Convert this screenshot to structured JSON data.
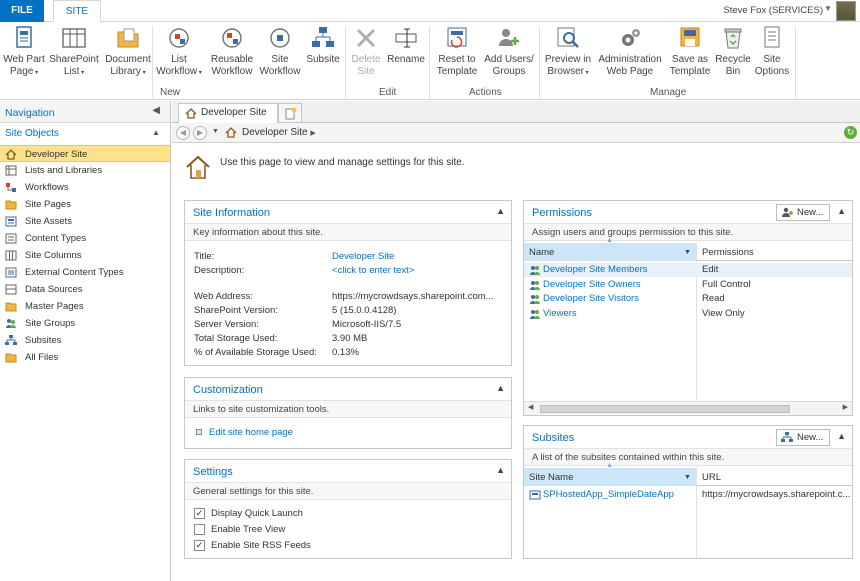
{
  "topbar": {
    "tabs": [
      {
        "label": "FILE"
      },
      {
        "label": "SITE"
      }
    ],
    "user": "Steve Fox (SERVICES)"
  },
  "ribbon": {
    "buttons": [
      {
        "label": "Web Part\nPage",
        "icon": "web-part-page-icon"
      },
      {
        "label": "SharePoint\nList",
        "icon": "sharepoint-list-icon"
      },
      {
        "label": "Document\nLibrary",
        "icon": "document-library-icon"
      },
      {
        "label": "List\nWorkflow",
        "icon": "list-workflow-icon"
      },
      {
        "label": "Reusable\nWorkflow",
        "icon": "reusable-workflow-icon"
      },
      {
        "label": "Site\nWorkflow",
        "icon": "site-workflow-icon"
      },
      {
        "label": "Subsite",
        "icon": "subsite-icon"
      },
      {
        "label": "Delete\nSite",
        "icon": "delete-icon"
      },
      {
        "label": "Rename",
        "icon": "rename-icon"
      },
      {
        "label": "Reset to\nTemplate",
        "icon": "reset-template-icon"
      },
      {
        "label": "Add Users/\nGroups",
        "icon": "add-users-icon"
      },
      {
        "label": "Preview in\nBrowser",
        "icon": "preview-browser-icon"
      },
      {
        "label": "Administration\nWeb Page",
        "icon": "admin-gear-icon"
      },
      {
        "label": "Save as\nTemplate",
        "icon": "save-template-icon"
      },
      {
        "label": "Recycle\nBin",
        "icon": "recycle-bin-icon"
      },
      {
        "label": "Site\nOptions",
        "icon": "site-options-icon"
      }
    ],
    "groups": [
      "New",
      "Edit",
      "Actions",
      "Manage"
    ]
  },
  "nav": {
    "header": "Navigation",
    "section": "Site Objects",
    "items": [
      {
        "label": "Developer Site",
        "icon": "home-icon"
      },
      {
        "label": "Lists and Libraries",
        "icon": "list-icon"
      },
      {
        "label": "Workflows",
        "icon": "workflow-icon"
      },
      {
        "label": "Site Pages",
        "icon": "pages-icon"
      },
      {
        "label": "Site Assets",
        "icon": "assets-icon"
      },
      {
        "label": "Content Types",
        "icon": "content-types-icon"
      },
      {
        "label": "Site Columns",
        "icon": "columns-icon"
      },
      {
        "label": "External Content Types",
        "icon": "external-content-icon"
      },
      {
        "label": "Data Sources",
        "icon": "data-sources-icon"
      },
      {
        "label": "Master Pages",
        "icon": "master-pages-icon"
      },
      {
        "label": "Site Groups",
        "icon": "groups-icon"
      },
      {
        "label": "Subsites",
        "icon": "subsites-icon"
      },
      {
        "label": "All Files",
        "icon": "folder-icon"
      }
    ]
  },
  "doc": {
    "tab": "Developer Site",
    "breadcrumb": "Developer Site",
    "intro": "Use this page to view and manage settings for this site."
  },
  "site_info": {
    "title": "Site Information",
    "desc": "Key information about this site.",
    "rows": [
      {
        "label": "Title:",
        "value": "Developer Site"
      },
      {
        "label": "Description:",
        "value": "<click to enter text>"
      },
      {
        "label": "Web Address:",
        "value": "https://mycrowdsays.sharepoint.com..."
      },
      {
        "label": "SharePoint Version:",
        "value": "5 (15.0.0.4128)"
      },
      {
        "label": "Server Version:",
        "value": "Microsoft-IIS/7.5"
      },
      {
        "label": "Total Storage Used:",
        "value": "3.90 MB"
      },
      {
        "label": "% of Available Storage Used:",
        "value": "0.13%"
      }
    ]
  },
  "customization": {
    "title": "Customization",
    "desc": "Links to site customization tools.",
    "link": "Edit site home page"
  },
  "settings": {
    "title": "Settings",
    "desc": "General settings for this site.",
    "options": [
      {
        "label": "Display Quick Launch",
        "checked": true
      },
      {
        "label": "Enable Tree View",
        "checked": false
      },
      {
        "label": "Enable Site RSS Feeds",
        "checked": true
      }
    ]
  },
  "permissions": {
    "title": "Permissions",
    "new_label": "New...",
    "desc": "Assign users and groups permission to this site.",
    "col_name": "Name",
    "col_perm": "Permissions",
    "rows": [
      {
        "name": "Developer Site Members",
        "perm": "Edit"
      },
      {
        "name": "Developer Site Owners",
        "perm": "Full Control"
      },
      {
        "name": "Developer Site Visitors",
        "perm": "Read"
      },
      {
        "name": "Viewers",
        "perm": "View Only"
      }
    ]
  },
  "subsites": {
    "title": "Subsites",
    "new_label": "New...",
    "desc": "A list of the subsites contained within this site.",
    "col_name": "Site Name",
    "col_url": "URL",
    "rows": [
      {
        "name": "SPHostedApp_SimpleDateApp",
        "url": "https://mycrowdsays.sharepoint.c..."
      }
    ]
  }
}
